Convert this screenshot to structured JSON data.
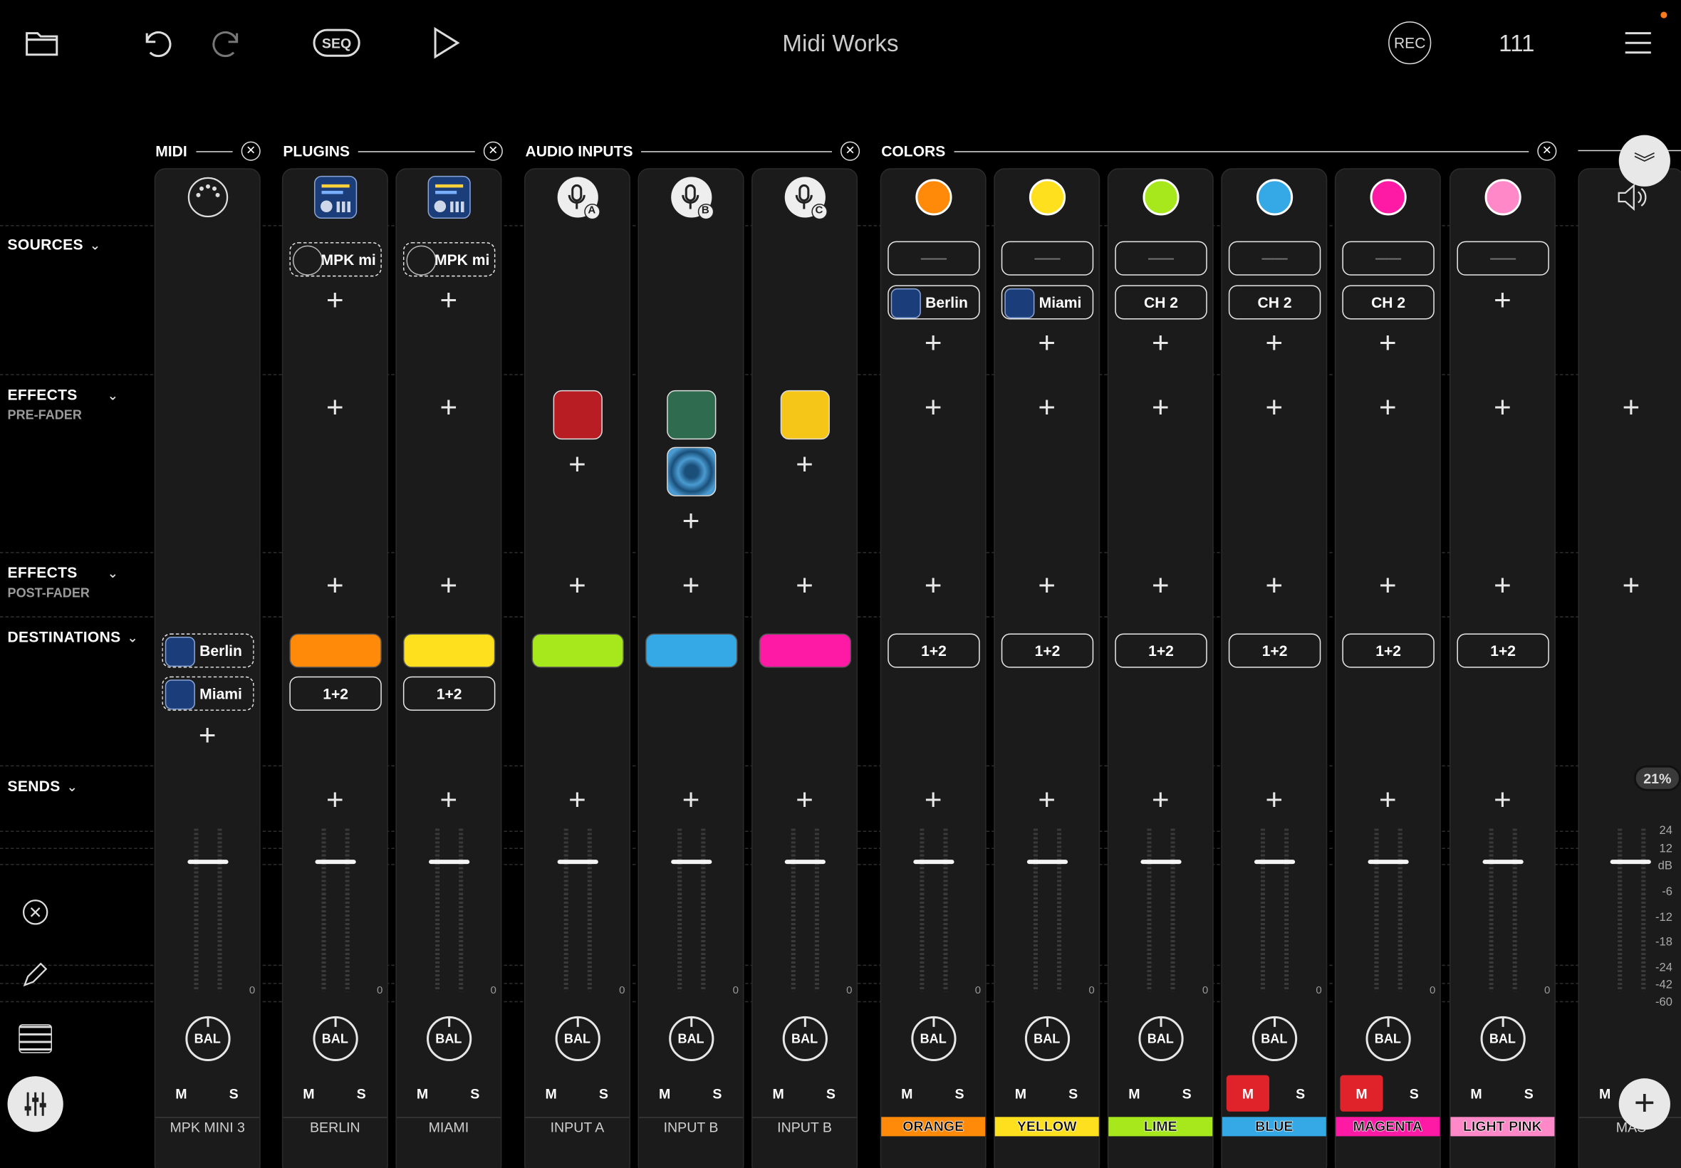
{
  "app": {
    "title": "Midi Works",
    "tempo": "111"
  },
  "toolbar": {
    "seq_label": "SEQ",
    "rec_label": "REC"
  },
  "groups": [
    {
      "name": "MIDI"
    },
    {
      "name": "PLUGINS"
    },
    {
      "name": "AUDIO INPUTS"
    },
    {
      "name": "COLORS"
    }
  ],
  "sections": {
    "sources": "SOURCES",
    "effects_pre": "EFFECTS",
    "pre_fader": "PRE-FADER",
    "effects_post": "EFFECTS",
    "post_fader": "POST-FADER",
    "destinations": "DESTINATIONS",
    "sends": "SENDS"
  },
  "channels": [
    {
      "name": "MPK MINI 3",
      "mute": "M",
      "solo": "S",
      "bal": "BAL",
      "meter_zero": "0"
    },
    {
      "name": "BERLIN",
      "mute": "M",
      "solo": "S",
      "bal": "BAL",
      "meter_zero": "0",
      "source": "MPK mi",
      "dest_color": "#ff8a0a",
      "dest": "1+2"
    },
    {
      "name": "MIAMI",
      "mute": "M",
      "solo": "S",
      "bal": "BAL",
      "meter_zero": "0",
      "source": "MPK mi",
      "dest_color": "#ffe01f",
      "dest": "1+2"
    },
    {
      "name": "INPUT A",
      "mute": "M",
      "solo": "S",
      "bal": "BAL",
      "meter_zero": "0",
      "dest_color": "#a6e81c"
    },
    {
      "name": "INPUT B",
      "mute": "M",
      "solo": "S",
      "bal": "BAL",
      "meter_zero": "0",
      "dest_color": "#35a9e6"
    },
    {
      "name": "INPUT B",
      "mute": "M",
      "solo": "S",
      "bal": "BAL",
      "meter_zero": "0",
      "dest_color": "#ff1aa6"
    },
    {
      "name": "ORANGE",
      "mute": "M",
      "solo": "S",
      "bal": "BAL",
      "meter_zero": "0",
      "color": "#ff8a0a",
      "source_empty": "——",
      "source": "Berlin",
      "dest": "1+2"
    },
    {
      "name": "YELLOW",
      "mute": "M",
      "solo": "S",
      "bal": "BAL",
      "meter_zero": "0",
      "color": "#ffe01f",
      "source_empty": "——",
      "source": "Miami",
      "dest": "1+2"
    },
    {
      "name": "LIME",
      "mute": "M",
      "solo": "S",
      "bal": "BAL",
      "meter_zero": "0",
      "color": "#a6e81c",
      "source_empty": "——",
      "source": "CH 2",
      "dest": "1+2"
    },
    {
      "name": "BLUE",
      "mute": "M",
      "solo": "S",
      "bal": "BAL",
      "meter_zero": "0",
      "color": "#35a9e6",
      "source_empty": "——",
      "source": "CH 2",
      "dest": "1+2",
      "muted": true
    },
    {
      "name": "MAGENTA",
      "mute": "M",
      "solo": "S",
      "bal": "BAL",
      "meter_zero": "0",
      "color": "#ff1aa6",
      "source_empty": "——",
      "source": "CH 2",
      "dest": "1+2",
      "muted": true
    },
    {
      "name": "LIGHT PINK",
      "mute": "M",
      "solo": "S",
      "bal": "BAL",
      "meter_zero": "0",
      "color": "#ff88c8",
      "source_empty": "——",
      "dest": "1+2"
    },
    {
      "name": "MAS",
      "mute": "M"
    }
  ],
  "midi_destinations": [
    "Berlin",
    "Miami"
  ],
  "master": {
    "zoom": "21%",
    "scale": [
      "24",
      "12",
      "dB",
      "-6",
      "-12",
      "-18",
      "-24",
      "-42",
      "-60"
    ]
  },
  "colors": {
    "mute_on": "#e0222b",
    "strip_bg": "#1b1b1b"
  }
}
